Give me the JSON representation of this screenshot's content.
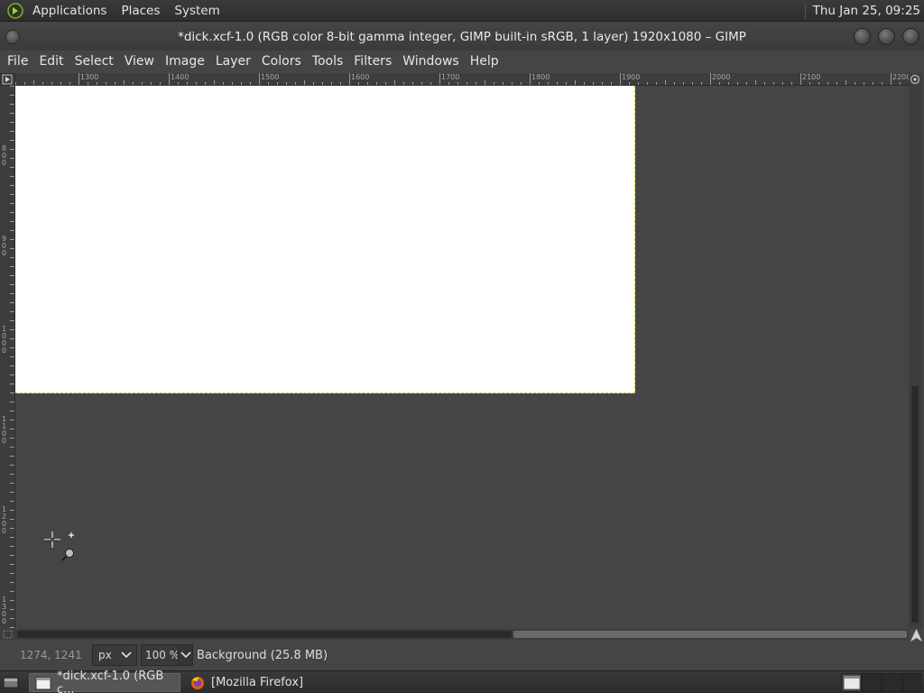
{
  "top_panel": {
    "menus": [
      "Applications",
      "Places",
      "System"
    ],
    "clock": "Thu Jan 25, 09:25"
  },
  "window": {
    "title": "*dick.xcf-1.0 (RGB color 8-bit gamma integer, GIMP built-in sRGB, 1 layer) 1920x1080 – GIMP"
  },
  "menu_bar": {
    "items": [
      "File",
      "Edit",
      "Select",
      "View",
      "Image",
      "Layer",
      "Colors",
      "Tools",
      "Filters",
      "Windows",
      "Help"
    ]
  },
  "rulers": {
    "horizontal_labels": [
      "1300",
      "1400",
      "1500",
      "1600",
      "1700",
      "1800",
      "1900",
      "2000",
      "2100",
      "2200"
    ],
    "vertical_labels": [
      "800",
      "900",
      "1000",
      "1100",
      "1200",
      "1300"
    ]
  },
  "status_bar": {
    "pointer_coords": "1274, 1241",
    "unit": "px",
    "zoom": "100 %",
    "message": "Background (25.8 MB)"
  },
  "taskbar": {
    "tasks": [
      {
        "label": "*dick.xcf-1.0 (RGB c...",
        "icon": "gimp-window-icon",
        "active": true
      },
      {
        "label": "[Mozilla Firefox]",
        "icon": "firefox-icon",
        "active": false
      }
    ]
  },
  "colors": {
    "canvas_bg": "#454545",
    "image_fill": "#ffffff",
    "selection_border": "#d8c020"
  }
}
